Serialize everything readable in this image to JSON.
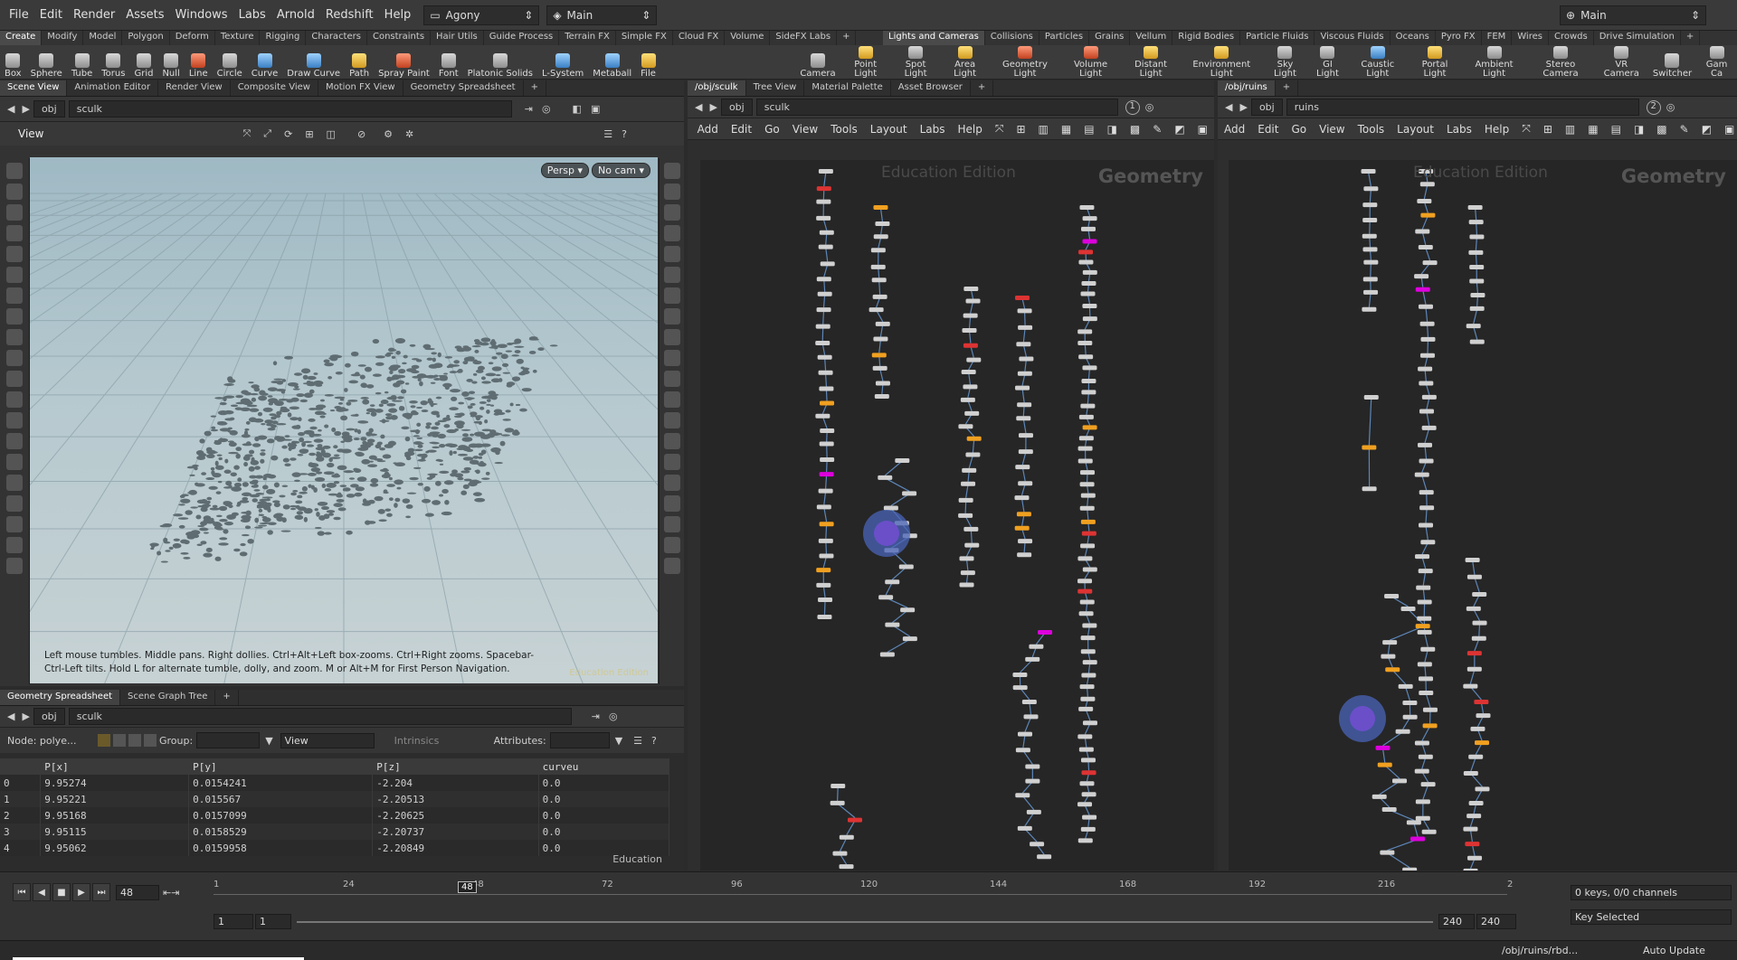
{
  "menubar": {
    "items": [
      "File",
      "Edit",
      "Render",
      "Assets",
      "Windows",
      "Labs",
      "Arnold",
      "Redshift",
      "Help"
    ],
    "desktop": "Agony",
    "context": "Main",
    "right_desktop": "Main"
  },
  "shelf_tabs_left": [
    "Create",
    "Modify",
    "Model",
    "Polygon",
    "Deform",
    "Texture",
    "Rigging",
    "Characters",
    "Constraints",
    "Hair Utils",
    "Guide Process",
    "Terrain FX",
    "Simple FX",
    "Cloud FX",
    "Volume",
    "SideFX Labs",
    "+"
  ],
  "shelf_tabs_right": [
    "Lights and Cameras",
    "Collisions",
    "Particles",
    "Grains",
    "Vellum",
    "Rigid Bodies",
    "Particle Fluids",
    "Viscous Fluids",
    "Oceans",
    "Pyro FX",
    "FEM",
    "Wires",
    "Crowds",
    "Drive Simulation",
    "+"
  ],
  "tools_left": [
    {
      "label": "Box",
      "c": ""
    },
    {
      "label": "Sphere",
      "c": ""
    },
    {
      "label": "Tube",
      "c": ""
    },
    {
      "label": "Torus",
      "c": ""
    },
    {
      "label": "Grid",
      "c": ""
    },
    {
      "label": "Null",
      "c": ""
    },
    {
      "label": "Line",
      "c": "r"
    },
    {
      "label": "Circle",
      "c": ""
    },
    {
      "label": "Curve",
      "c": "b"
    },
    {
      "label": "Draw Curve",
      "c": "b"
    },
    {
      "label": "Path",
      "c": "y"
    },
    {
      "label": "Spray Paint",
      "c": "r"
    },
    {
      "label": "Font",
      "c": ""
    },
    {
      "label": "Platonic Solids",
      "c": ""
    },
    {
      "label": "L-System",
      "c": "b"
    },
    {
      "label": "Metaball",
      "c": "b"
    },
    {
      "label": "File",
      "c": "y"
    }
  ],
  "tools_right": [
    {
      "label": "Camera",
      "c": ""
    },
    {
      "label": "Point Light",
      "c": "y"
    },
    {
      "label": "Spot Light",
      "c": ""
    },
    {
      "label": "Area Light",
      "c": "y"
    },
    {
      "label": "Geometry Light",
      "c": "r"
    },
    {
      "label": "Volume Light",
      "c": "r"
    },
    {
      "label": "Distant Light",
      "c": "y"
    },
    {
      "label": "Environment Light",
      "c": "y"
    },
    {
      "label": "Sky Light",
      "c": ""
    },
    {
      "label": "GI Light",
      "c": ""
    },
    {
      "label": "Caustic Light",
      "c": "b"
    },
    {
      "label": "Portal Light",
      "c": "y"
    },
    {
      "label": "Ambient Light",
      "c": ""
    },
    {
      "label": "Stereo Camera",
      "c": ""
    },
    {
      "label": "VR Camera",
      "c": ""
    },
    {
      "label": "Switcher",
      "c": ""
    },
    {
      "label": "Gam Ca",
      "c": ""
    }
  ],
  "scene_pane": {
    "tabs": [
      "Scene View",
      "Animation Editor",
      "Render View",
      "Composite View",
      "Motion FX View",
      "Geometry Spreadsheet",
      "+"
    ],
    "path": [
      "obj",
      "sculk"
    ],
    "view_label": "View",
    "persp": "Persp ▾",
    "nocam": "No cam ▾",
    "hint": "Left mouse tumbles. Middle pans. Right dollies. Ctrl+Alt+Left box-zooms. Ctrl+Right zooms. Spacebar-Ctrl-Left tilts. Hold L for alternate tumble, dolly, and zoom.     M or Alt+M for First Person Navigation.",
    "edition": "Education Edition"
  },
  "spreadsheet": {
    "tabs": [
      "Geometry Spreadsheet",
      "Scene Graph Tree",
      "+"
    ],
    "path": [
      "obj",
      "sculk"
    ],
    "node": "Node: polye...",
    "group_label": "Group:",
    "view_btn": "View",
    "intrinsics": "Intrinsics",
    "attributes_label": "Attributes:",
    "columns": [
      "",
      "P[x]",
      "P[y]",
      "P[z]",
      "curveu"
    ],
    "rows": [
      [
        "0",
        "9.95274",
        "0.0154241",
        "-2.204",
        "0.0"
      ],
      [
        "1",
        "9.95221",
        "0.015567",
        "-2.20513",
        "0.0"
      ],
      [
        "2",
        "9.95168",
        "0.0157099",
        "-2.20625",
        "0.0"
      ],
      [
        "3",
        "9.95115",
        "0.0158529",
        "-2.20737",
        "0.0"
      ],
      [
        "4",
        "9.95062",
        "0.0159958",
        "-2.20849",
        "0.0"
      ]
    ],
    "watermark": "Education"
  },
  "net1": {
    "tabs": [
      "/obj/sculk",
      "Tree View",
      "Material Palette",
      "Asset Browser",
      "+"
    ],
    "path": [
      "obj",
      "sculk"
    ],
    "pane_num": "1",
    "menus": [
      "Add",
      "Edit",
      "Go",
      "View",
      "Tools",
      "Layout",
      "Labs",
      "Help"
    ],
    "watermark": "Education Edition",
    "context": "Geometry"
  },
  "net2": {
    "tabs": [
      "/obj/ruins",
      "+"
    ],
    "path": [
      "obj",
      "ruins"
    ],
    "pane_num": "2",
    "menus": [
      "Add",
      "Edit",
      "Go",
      "View",
      "Tools",
      "Layout",
      "Labs",
      "Help"
    ],
    "watermark": "Education Edition",
    "context": "Geometry"
  },
  "timeline": {
    "frame": "48",
    "marker": "48",
    "ticks": [
      "1",
      "24",
      "48",
      "72",
      "96",
      "120",
      "144",
      "168",
      "192",
      "216",
      "2"
    ],
    "start": "1",
    "start2": "1",
    "end": "240",
    "end2": "240",
    "keys": "0 keys, 0/0 channels",
    "key_mode": "Key Selected"
  },
  "statusbar": {
    "path": "/obj/ruins/rbd...",
    "update": "Auto Update"
  },
  "colors": {
    "accent": "#f0a020",
    "node": "#d0d0d0",
    "wire": "#5d86b8",
    "selected": "#6a4fc9"
  }
}
